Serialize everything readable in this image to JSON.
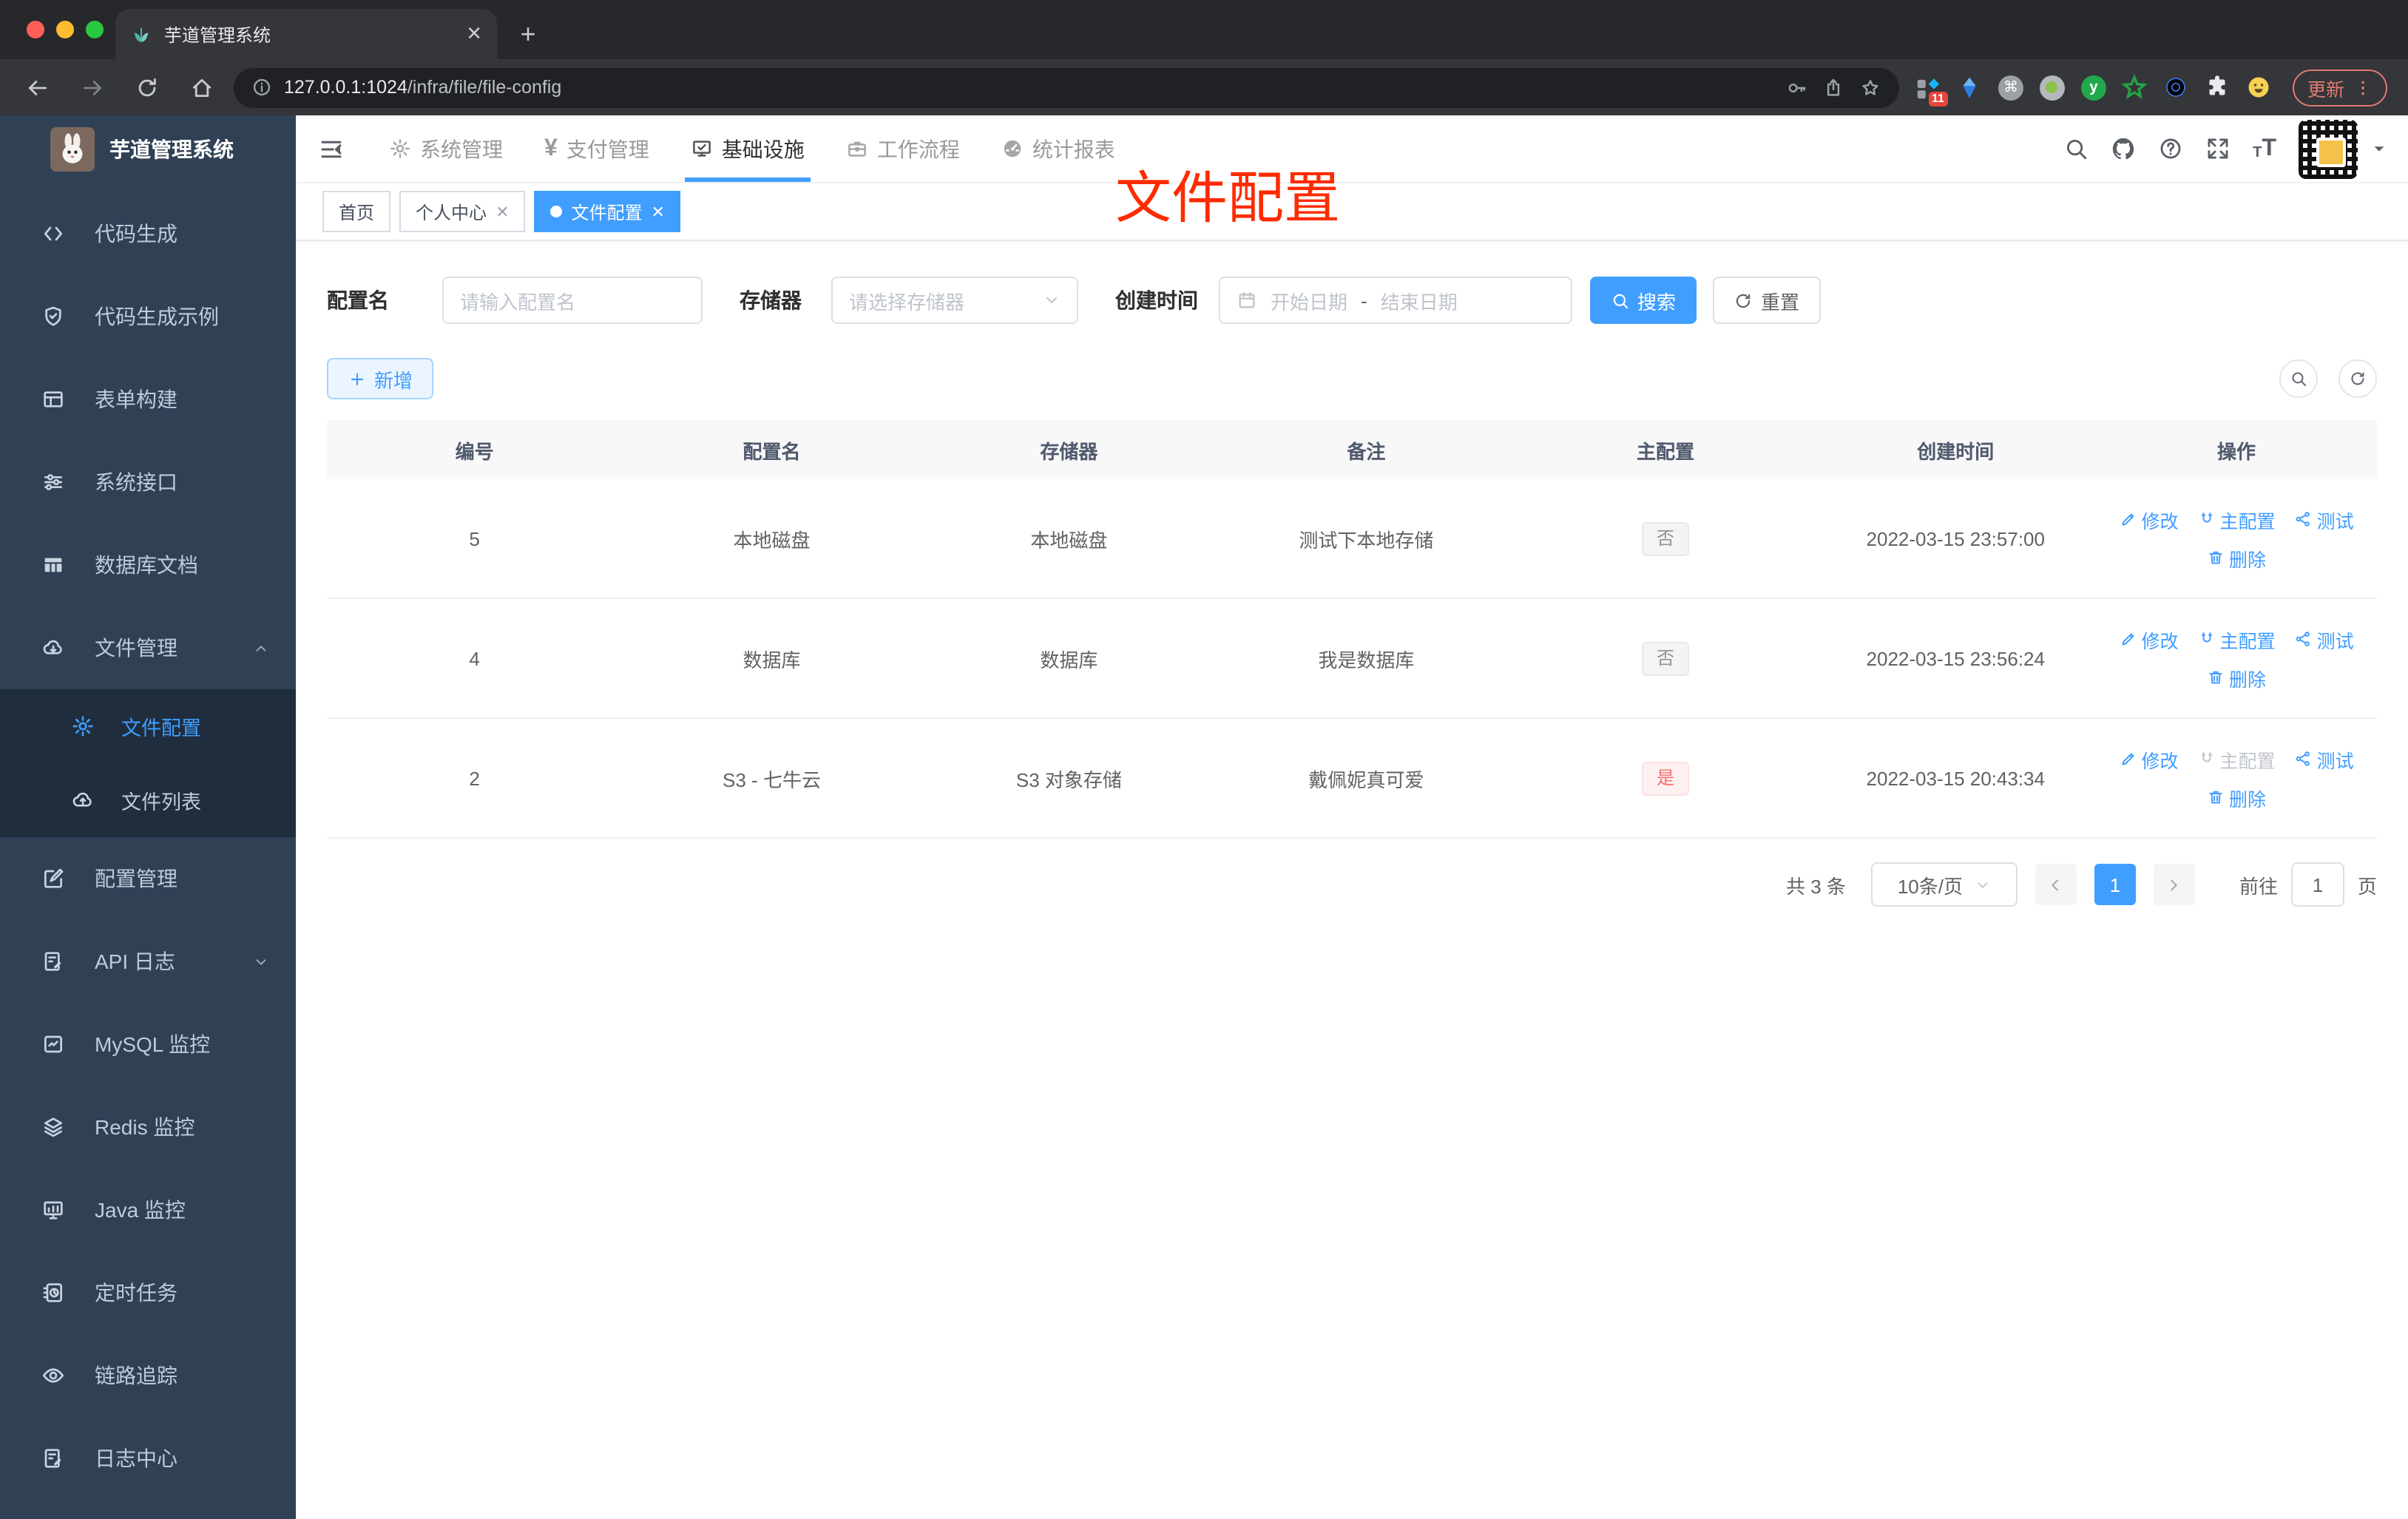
{
  "browser": {
    "tab_title": "芋道管理系统",
    "tab_close_glyph": "✕",
    "new_tab_glyph": "+",
    "url_host": "127.0.0.1:1024",
    "url_path": "/infra/file/file-config",
    "ext_badge": "11",
    "update_label": "更新"
  },
  "sidebar": {
    "logo_title": "芋道管理系统",
    "items": [
      {
        "label": "代码生成",
        "icon": "code"
      },
      {
        "label": "代码生成示例",
        "icon": "shield"
      },
      {
        "label": "表单构建",
        "icon": "form"
      },
      {
        "label": "系统接口",
        "icon": "sliders"
      },
      {
        "label": "数据库文档",
        "icon": "dbtable"
      },
      {
        "label": "文件管理",
        "icon": "cloud-down",
        "chevron": "up",
        "submenu": [
          {
            "label": "文件配置",
            "icon": "gear",
            "active": true
          },
          {
            "label": "文件列表",
            "icon": "cloud-up"
          }
        ]
      },
      {
        "label": "配置管理",
        "icon": "edit-square"
      },
      {
        "label": "API 日志",
        "icon": "note-edit",
        "chevron": "down"
      },
      {
        "label": "MySQL 监控",
        "icon": "chartbox"
      },
      {
        "label": "Redis 监控",
        "icon": "layers"
      },
      {
        "label": "Java 监控",
        "icon": "monitor"
      },
      {
        "label": "定时任务",
        "icon": "timer"
      },
      {
        "label": "链路追踪",
        "icon": "eye"
      },
      {
        "label": "日志中心",
        "icon": "note-edit"
      }
    ]
  },
  "topnav": {
    "items": [
      {
        "label": "系统管理",
        "icon": "gear"
      },
      {
        "label": "支付管理",
        "icon": "yen"
      },
      {
        "label": "基础设施",
        "icon": "monitor-check",
        "active": true
      },
      {
        "label": "工作流程",
        "icon": "briefcase"
      },
      {
        "label": "统计报表",
        "icon": "gauge"
      }
    ]
  },
  "tags": [
    {
      "label": "首页",
      "closable": false,
      "active": false
    },
    {
      "label": "个人中心",
      "closable": true,
      "active": false
    },
    {
      "label": "文件配置",
      "closable": true,
      "active": true
    }
  ],
  "annotation": {
    "text": "文件配置"
  },
  "filters": {
    "config_name_label": "配置名",
    "config_name_placeholder": "请输入配置名",
    "storage_label": "存储器",
    "storage_placeholder": "请选择存储器",
    "create_time_label": "创建时间",
    "date_start_placeholder": "开始日期",
    "date_separator": "-",
    "date_end_placeholder": "结束日期",
    "search_label": "搜索",
    "reset_label": "重置"
  },
  "toolbar": {
    "add_label": "新增"
  },
  "table": {
    "headers": [
      "编号",
      "配置名",
      "存储器",
      "备注",
      "主配置",
      "创建时间",
      "操作"
    ],
    "action_labels": {
      "edit": "修改",
      "master": "主配置",
      "test": "测试",
      "delete": "删除"
    },
    "rows": [
      {
        "id": "5",
        "name": "本地磁盘",
        "storage": "本地磁盘",
        "remark": "测试下本地存储",
        "master": "否",
        "master_type": "info",
        "master_action_disabled": false,
        "created": "2022-03-15 23:57:00"
      },
      {
        "id": "4",
        "name": "数据库",
        "storage": "数据库",
        "remark": "我是数据库",
        "master": "否",
        "master_type": "info",
        "master_action_disabled": false,
        "created": "2022-03-15 23:56:24"
      },
      {
        "id": "2",
        "name": "S3 - 七牛云",
        "storage": "S3 对象存储",
        "remark": "戴佩妮真可爱",
        "master": "是",
        "master_type": "danger",
        "master_action_disabled": true,
        "created": "2022-03-15 20:43:34"
      }
    ]
  },
  "pagination": {
    "total": "共 3 条",
    "page_size": "10条/页",
    "current": "1",
    "goto_label": "前往",
    "goto_value": "1",
    "unit": "页"
  },
  "colors": {
    "accent": "#409eff",
    "sidebar_bg": "#304156",
    "submenu_bg": "#1f2d3d",
    "annotation_red": "#ff2b00",
    "tag_info_text": "#909399",
    "tag_danger_text": "#f56c6c"
  }
}
